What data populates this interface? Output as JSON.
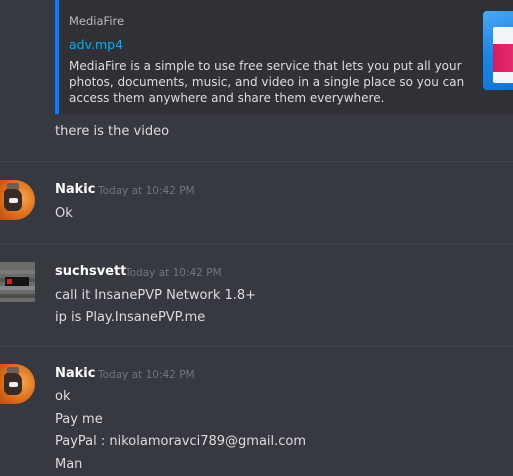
{
  "embed": {
    "provider": "MediaFire",
    "title": "adv.mp4",
    "description": "MediaFire is a simple to use free service that lets you put all your photos, documents, music, and video in a single place so you can access them anywhere and share them everywhere."
  },
  "messages": [
    {
      "author": "",
      "lines": [
        "there is the video"
      ]
    },
    {
      "author": "Nakic",
      "timestamp": "Today at 10:42 PM",
      "lines": [
        "Ok"
      ]
    },
    {
      "author": "suchsvett",
      "timestamp": "Today at 10:42 PM",
      "lines": [
        "call it InsanePVP Network 1.8+",
        "ip is Play.InsanePVP.me"
      ]
    },
    {
      "author": "Nakic",
      "timestamp": "Today at 10:42 PM",
      "lines": [
        "ok",
        "Pay me",
        "PayPal : nikolamoravci789@gmail.com",
        "Man"
      ]
    }
  ],
  "colors": {
    "background": "#36393f",
    "embed_background": "#2f3136",
    "embed_accent": "#0a7cff",
    "link": "#00b0f4",
    "text": "#dcddde",
    "username": "#ffffff",
    "timestamp": "#72767d"
  }
}
